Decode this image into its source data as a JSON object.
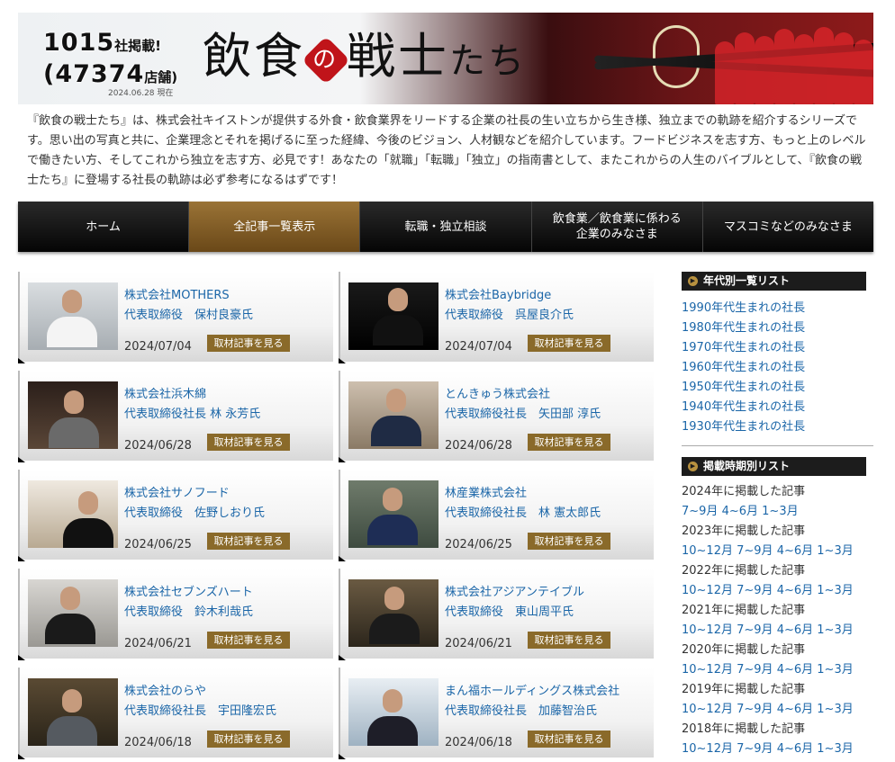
{
  "banner": {
    "count_companies": "1015",
    "count_companies_suffix": "社掲載!",
    "count_stores": "(47374",
    "count_stores_suffix": "店舗)",
    "as_of": "2024.06.28 現在",
    "title_a": "飲食",
    "title_no": "の",
    "title_b": "戦士",
    "title_c": "たち"
  },
  "intro": "『飲食の戦士たち』は、株式会社キイストンが提供する外食・飲食業界をリードする企業の社長の生い立ちから生き様、独立までの軌跡を紹介するシリーズです。思い出の写真と共に、企業理念とそれを掲げるに至った経緯、今後のビジョン、人材観などを紹介しています。フードビジネスを志す方、もっと上のレベルで働きたい方、そしてこれから独立を志す方、必見です！あなたの「就職」「転職」「独立」の指南書として、またこれからの人生のバイブルとして、『飲食の戦士たち』に登場する社長の軌跡は必ず参考になるはずです！",
  "nav": [
    {
      "label": "ホーム"
    },
    {
      "label": "全記事一覧表示"
    },
    {
      "label": "転職・独立相談"
    },
    {
      "label": "飲食業／飲食業に係わる\n企業のみなさま"
    },
    {
      "label": "マスコミなどのみなさま"
    }
  ],
  "cards": [
    {
      "company": "株式会社MOTHERS",
      "person": "代表取締役　保村良豪氏",
      "date": "2024/07/04",
      "button": "取材記事を見る"
    },
    {
      "company": "株式会社Baybridge",
      "person": "代表取締役　呉屋良介氏",
      "date": "2024/07/04",
      "button": "取材記事を見る"
    },
    {
      "company": "株式会社浜木綿",
      "person": "代表取締役社長 林 永芳氏",
      "date": "2024/06/28",
      "button": "取材記事を見る"
    },
    {
      "company": "とんきゅう株式会社",
      "person": "代表取締役社長　矢田部 淳氏",
      "date": "2024/06/28",
      "button": "取材記事を見る"
    },
    {
      "company": "株式会社サノフード",
      "person": "代表取締役　佐野しおり氏",
      "date": "2024/06/25",
      "button": "取材記事を見る"
    },
    {
      "company": "林産業株式会社",
      "person": "代表取締役社長　林 憲太郎氏",
      "date": "2024/06/25",
      "button": "取材記事を見る"
    },
    {
      "company": "株式会社セブンズハート",
      "person": "代表取締役　鈴木利哉氏",
      "date": "2024/06/21",
      "button": "取材記事を見る"
    },
    {
      "company": "株式会社アジアンテイブル",
      "person": "代表取締役　東山周平氏",
      "date": "2024/06/21",
      "button": "取材記事を見る"
    },
    {
      "company": "株式会社のらや",
      "person": "代表取締役社長　宇田隆宏氏",
      "date": "2024/06/18",
      "button": "取材記事を見る"
    },
    {
      "company": "まん福ホールディングス株式会社",
      "person": "代表取締役社長　加藤智治氏",
      "date": "2024/06/18",
      "button": "取材記事を見る"
    }
  ],
  "sidebar": {
    "decade_head": "年代別一覧リスト",
    "decades": [
      "1990年代生まれの社長",
      "1980年代生まれの社長",
      "1970年代生まれの社長",
      "1960年代生まれの社長",
      "1950年代生まれの社長",
      "1940年代生まれの社長",
      "1930年代生まれの社長"
    ],
    "period_head": "掲載時期別リスト",
    "years": [
      {
        "year": "2024年に掲載した記事",
        "quarters": [
          "7~9月",
          "4~6月",
          "1~3月"
        ]
      },
      {
        "year": "2023年に掲載した記事",
        "quarters": [
          "10~12月",
          "7~9月",
          "4~6月",
          "1~3月"
        ]
      },
      {
        "year": "2022年に掲載した記事",
        "quarters": [
          "10~12月",
          "7~9月",
          "4~6月",
          "1~3月"
        ]
      },
      {
        "year": "2021年に掲載した記事",
        "quarters": [
          "10~12月",
          "7~9月",
          "4~6月",
          "1~3月"
        ]
      },
      {
        "year": "2020年に掲載した記事",
        "quarters": [
          "10~12月",
          "7~9月",
          "4~6月",
          "1~3月"
        ]
      },
      {
        "year": "2019年に掲載した記事",
        "quarters": [
          "10~12月",
          "7~9月",
          "4~6月",
          "1~3月"
        ]
      },
      {
        "year": "2018年に掲載した記事",
        "quarters": [
          "10~12月",
          "7~9月",
          "4~6月",
          "1~3月"
        ]
      }
    ]
  }
}
